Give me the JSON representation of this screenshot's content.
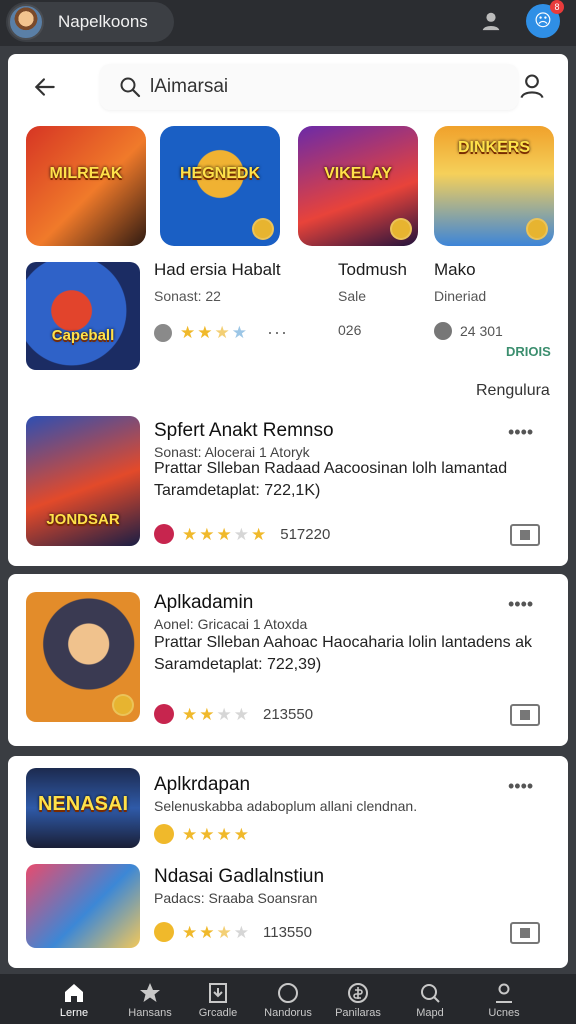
{
  "account": {
    "name": "Napelkoons",
    "notification_badge": "8"
  },
  "search": {
    "value": "lAimarsai"
  },
  "tiles": [
    {
      "label": "MILREAK",
      "colors": [
        "#d63524",
        "#f07a2a"
      ]
    },
    {
      "label": "HEGNEDK",
      "colors": [
        "#1a5fc4",
        "#f0b232"
      ]
    },
    {
      "label": "VIKELAY",
      "colors": [
        "#6b2aa8",
        "#e8433a"
      ]
    },
    {
      "label": "DINKERS",
      "colors": [
        "#f0a12b",
        "#3d85d8"
      ]
    }
  ],
  "featured": {
    "image_label": "Capeball",
    "tag": "DRIOIS",
    "columns": [
      {
        "title": "Had ersia Habalt",
        "subtitle": "Sonast: 22",
        "rating_stars": 2.5,
        "extra": "···"
      },
      {
        "title": "Todmush",
        "subtitle": "Sale",
        "value": "026"
      },
      {
        "title": "Mako",
        "subtitle": "Dineriad",
        "value": "24 301"
      }
    ]
  },
  "section_link": "Rengulura",
  "apps": [
    {
      "title": "Spfert Anakt Remnso",
      "line1": "Sonast: Alocerai 1 Atoryk",
      "line2": "Prattar Slleban Radaad Aacoosinan lolh lamantad",
      "line3": "Taramdetaplat: 722,1K)",
      "image_label": "JONDSAR",
      "rating_stars": 3,
      "count": "517220"
    },
    {
      "title": "Aplkadamin",
      "line1": "Aonel: Gricacai 1 Atoxda",
      "line2": "Prattar Slleban Aahoac Haocaharia lolin lantadens ak",
      "line3": "Saramdetaplat: 722,39)",
      "image_label": "",
      "rating_stars": 2,
      "count": "213550"
    }
  ],
  "card3": {
    "top": {
      "title": "Aplkrdapan",
      "line1": "Selenuskabba adaboplum allani clendnan.",
      "image_label": "NENASAI",
      "rating_stars": 4
    },
    "bottom": {
      "title": "Ndasai Gadlalnstiun",
      "line1": "Padacs: Sraaba Soansran",
      "rating_stars": 2.5,
      "count": "113550"
    }
  },
  "bottom_nav": [
    {
      "label": "Lerne",
      "icon": "home-icon",
      "active": true
    },
    {
      "label": "Hansans",
      "icon": "star-icon"
    },
    {
      "label": "Grcadle",
      "icon": "download-icon"
    },
    {
      "label": "Nandorus",
      "icon": "circle-icon"
    },
    {
      "label": "Panilaras",
      "icon": "coin-icon"
    },
    {
      "label": "Mapd",
      "icon": "search-icon"
    },
    {
      "label": "Ucnes",
      "icon": "person-icon"
    }
  ]
}
